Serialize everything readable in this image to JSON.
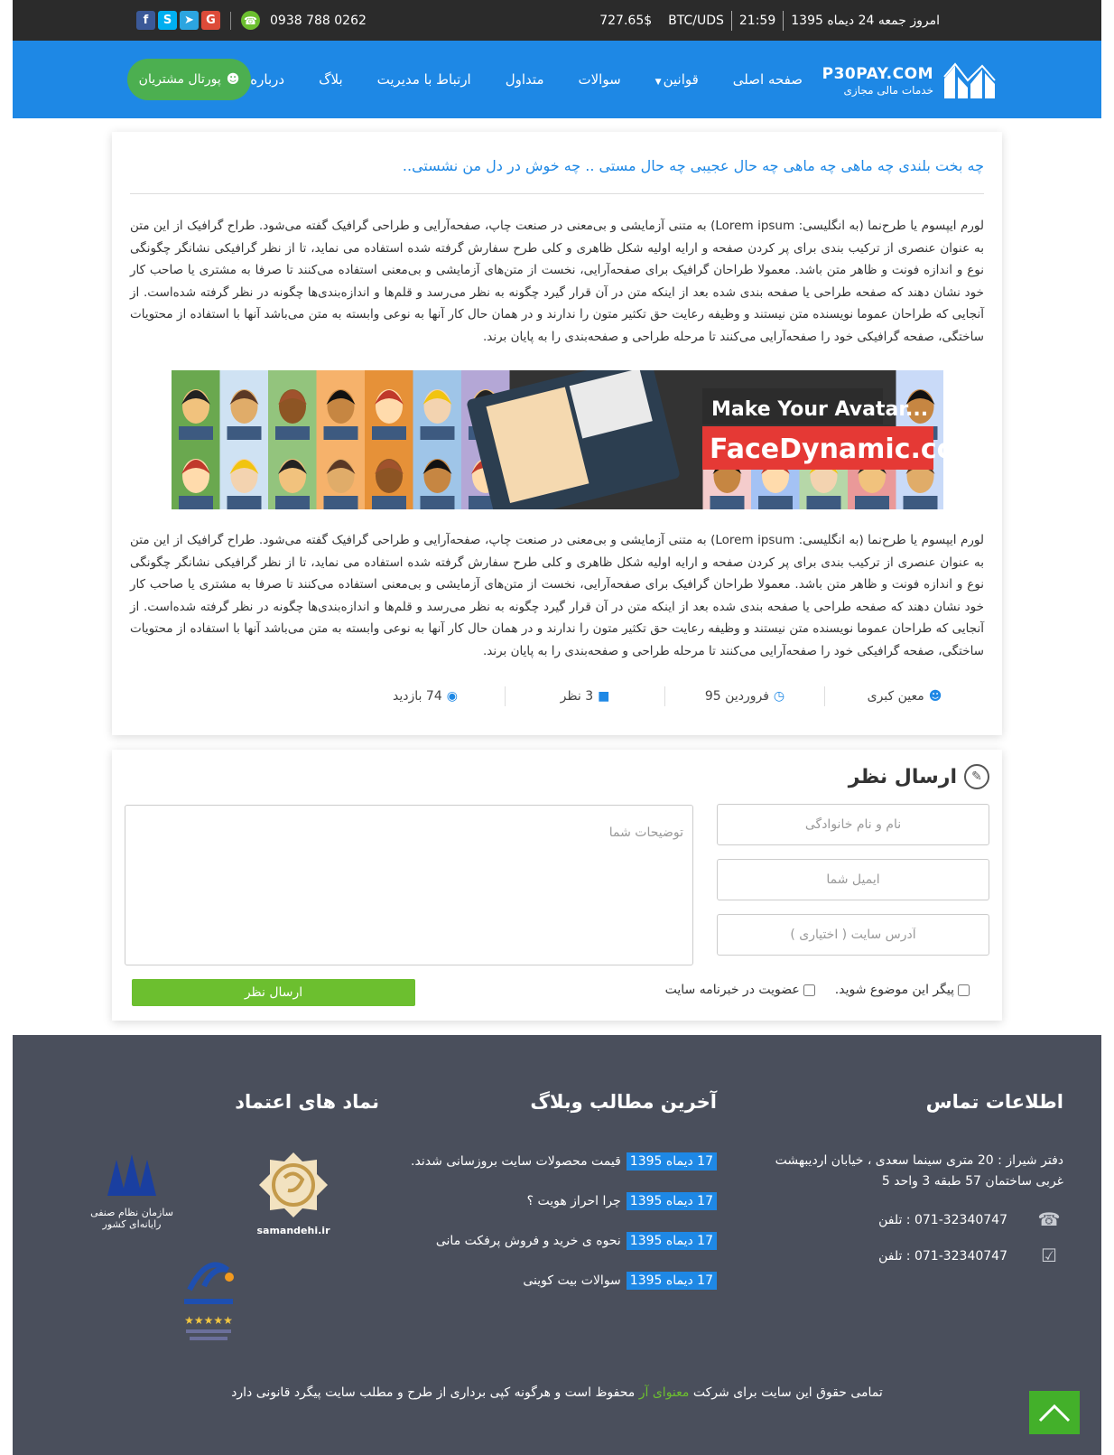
{
  "topbar": {
    "date": "امروز جمعه 24 دیماه 1395",
    "time": "21:59",
    "pair": "BTC/UDS",
    "price": "727.65$",
    "phone": "0938 788 0262",
    "social_icons": [
      "facebook-icon",
      "skype-icon",
      "telegram-icon",
      "google-icon"
    ]
  },
  "brand": {
    "name": "P30PAY.COM",
    "subtitle": "خدمات مالی مجازی"
  },
  "nav": {
    "items": [
      "صفحه اصلی",
      "قوانین",
      "سوالات",
      "متداول",
      "ارتباط با مدیریت",
      "بلاگ",
      "درباره ما"
    ],
    "portal_label": "پورتال مشتریان"
  },
  "article": {
    "title": "چه بخت بلندی چه ماهی چه ماهی چه حال عجیبی چه حال مستی .. چه خوش در دل من نشستی..",
    "paragraph1": "لورم ایپسوم یا طرح‌نما (به انگلیسی: Lorem ipsum) به متنی آزمایشی و بی‌معنی در صنعت چاپ، صفحه‌آرایی و طراحی گرافیک گفته می‌شود. طراح گرافیک از این متن به عنوان عنصری از ترکیب بندی برای پر کردن صفحه و ارایه اولیه شکل ظاهری و کلی طرح سفارش گرفته شده استفاده می نماید، تا از نظر گرافیکی نشانگر چگونگی نوع و اندازه فونت و ظاهر متن باشد. معمولا طراحان گرافیک برای صفحه‌آرایی، نخست از متن‌های آزمایشی و بی‌معنی استفاده می‌کنند تا صرفا به مشتری یا صاحب کار خود نشان دهند که صفحه طراحی یا صفحه بندی شده بعد از اینکه متن در آن قرار گیرد چگونه به نظر می‌رسد و قلم‌ها و اندازه‌بندی‌ها چگونه در نظر گرفته شده‌است. از آنجایی که طراحان عموما نویسنده متن نیستند و وظیفه رعایت حق تکثیر متون را ندارند و در همان حال کار آنها به نوعی وابسته به متن می‌باشد آنها با استفاده از محتویات ساختگی، صفحه گرافیکی خود را صفحه‌آرایی می‌کنند تا مرحله طراحی و صفحه‌بندی را به پایان برند.",
    "paragraph2": "لورم ایپسوم یا طرح‌نما (به انگلیسی: Lorem ipsum) به متنی آزمایشی و بی‌معنی در صنعت چاپ، صفحه‌آرایی و طراحی گرافیک گفته می‌شود. طراح گرافیک از این متن به عنوان عنصری از ترکیب بندی برای پر کردن صفحه و ارایه اولیه شکل ظاهری و کلی طرح سفارش گرفته شده استفاده می نماید، تا از نظر گرافیکی نشانگر چگونگی نوع و اندازه فونت و ظاهر متن باشد. معمولا طراحان گرافیک برای صفحه‌آرایی، نخست از متن‌های آزمایشی و بی‌معنی استفاده می‌کنند تا صرفا به مشتری یا صاحب کار خود نشان دهند که صفحه طراحی یا صفحه بندی شده بعد از اینکه متن در آن قرار گیرد چگونه به نظر می‌رسد و قلم‌ها و اندازه‌بندی‌ها چگونه در نظر گرفته شده‌است. از آنجایی که طراحان عموما نویسنده متن نیستند و وظیفه رعایت حق تکثیر متون را ندارند و در همان حال کار آنها به نوعی وابسته به متن می‌باشد آنها با استفاده از محتویات ساختگی، صفحه گرافیکی خود را صفحه‌آرایی می‌کنند تا مرحله طراحی و صفحه‌بندی را به پایان برند.",
    "banner": {
      "line1": "Make Your Avatar...",
      "line2": "FaceDynamic.com"
    },
    "meta": {
      "author": "معین کبری",
      "date": "فروردین 95",
      "comments": "3 نظر",
      "views": "74 بازدید"
    }
  },
  "comment_form": {
    "title": "ارسال نظر",
    "name_placeholder": "نام و نام خانوادگی",
    "email_placeholder": "ایمیل شما",
    "site_placeholder": "آدرس سایت ( اختیاری )",
    "message_placeholder": "توضیحات شما",
    "follow_label": "پیگر این موضوع شوید.",
    "newsletter_label": "عضویت در خبرنامه سایت",
    "submit_label": "ارسال نظر"
  },
  "footer": {
    "contact_title": "اطلاعات تماس",
    "address": "دفتر شیراز : 20 متری سینما سعدی ، خیابان اردیبهشت غربی ساختمان 57 طبقه 3 واحد 5",
    "phone1": "071-32340747 : تلفن",
    "phone2": "071-32340747 : تلفن",
    "blog_title": "آخرین مطالب وبلاگ",
    "blog_items": [
      {
        "date": "17 دیماه 1395",
        "title": "قیمت محصولات سایت بروزسانی شدند."
      },
      {
        "date": "17 دیماه 1395",
        "title": "چرا احراز هویت ؟"
      },
      {
        "date": "17 دیماه 1395",
        "title": "نحوه ی خرید و فروش پرفکت مانی"
      },
      {
        "date": "17 دیماه 1395",
        "title": "سوالات بیت کوینی"
      }
    ],
    "trust_title": "نماد های اعتماد",
    "samandehi_label": "samandehi.ir",
    "nezam_label": "سازمان نظام صنفی رایانه‌ای کشور",
    "copyright_pre": "تمامی حقوق این سایت برای شرکت",
    "copyright_company": "معنوای آر",
    "copyright_post": "محفوظ است و هرگونه کپی برداری از طرح و مطلب سایت پیگرد قانونی دارد"
  },
  "colors": {
    "primary": "#1e88e5",
    "success": "#4caf50",
    "footer_bg": "#4a4f5c",
    "topbar_bg": "#2b2b2b"
  }
}
